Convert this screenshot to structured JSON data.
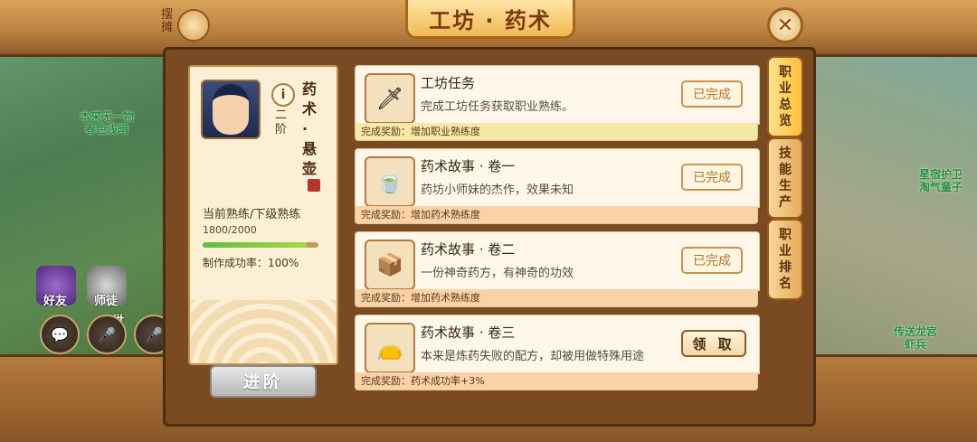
{
  "window": {
    "title": "工坊 · 药术",
    "stall_label": "摆摊",
    "close_label": "✕"
  },
  "scene_left": {
    "npc1": "本来无一物\n春色浅暗",
    "friend_label": "好友",
    "mentor_label": "师徒",
    "extra_label": "世"
  },
  "scene_right": {
    "npc1": "星宿护卫\n淘气童子",
    "npc2": "传送龙宫\n虾兵"
  },
  "profile": {
    "rank": "二阶",
    "name": "药术 · 悬壶",
    "progress_label": "当前熟练/下级熟练",
    "progress_value": "1800/2000",
    "progress_fraction": 0.9,
    "rate": "制作成功率：100%",
    "advance_label": "进阶"
  },
  "tasks": [
    {
      "name": "工坊任务",
      "desc": "完成工坊任务获取职业熟练。",
      "reward": "完成奖励：增加职业熟练度",
      "status": "已完成",
      "icon": "sword-icon",
      "reward_color": "yellow"
    },
    {
      "name": "药术故事 · 卷一",
      "desc": "药坊小师妹的杰作，效果未知",
      "reward": "完成奖励：增加药术熟练度",
      "status": "已完成",
      "icon": "bowl-icon",
      "reward_color": "orange"
    },
    {
      "name": "药术故事 · 卷二",
      "desc": "一份神奇药方，有神奇的功效",
      "reward": "完成奖励：增加药术熟练度",
      "status": "已完成",
      "icon": "chest-icon",
      "reward_color": "orange"
    },
    {
      "name": "药术故事 · 卷三",
      "desc": "本来是炼药失败的配方，却被用做特殊用途",
      "reward": "完成奖励：药术成功率+3%",
      "status": "领 取",
      "icon": "pouch-icon",
      "reward_color": "orange"
    }
  ],
  "tabs": [
    {
      "label": "职业总览",
      "active": true
    },
    {
      "label": "技能生产",
      "active": false
    },
    {
      "label": "职业排名",
      "active": false
    }
  ]
}
